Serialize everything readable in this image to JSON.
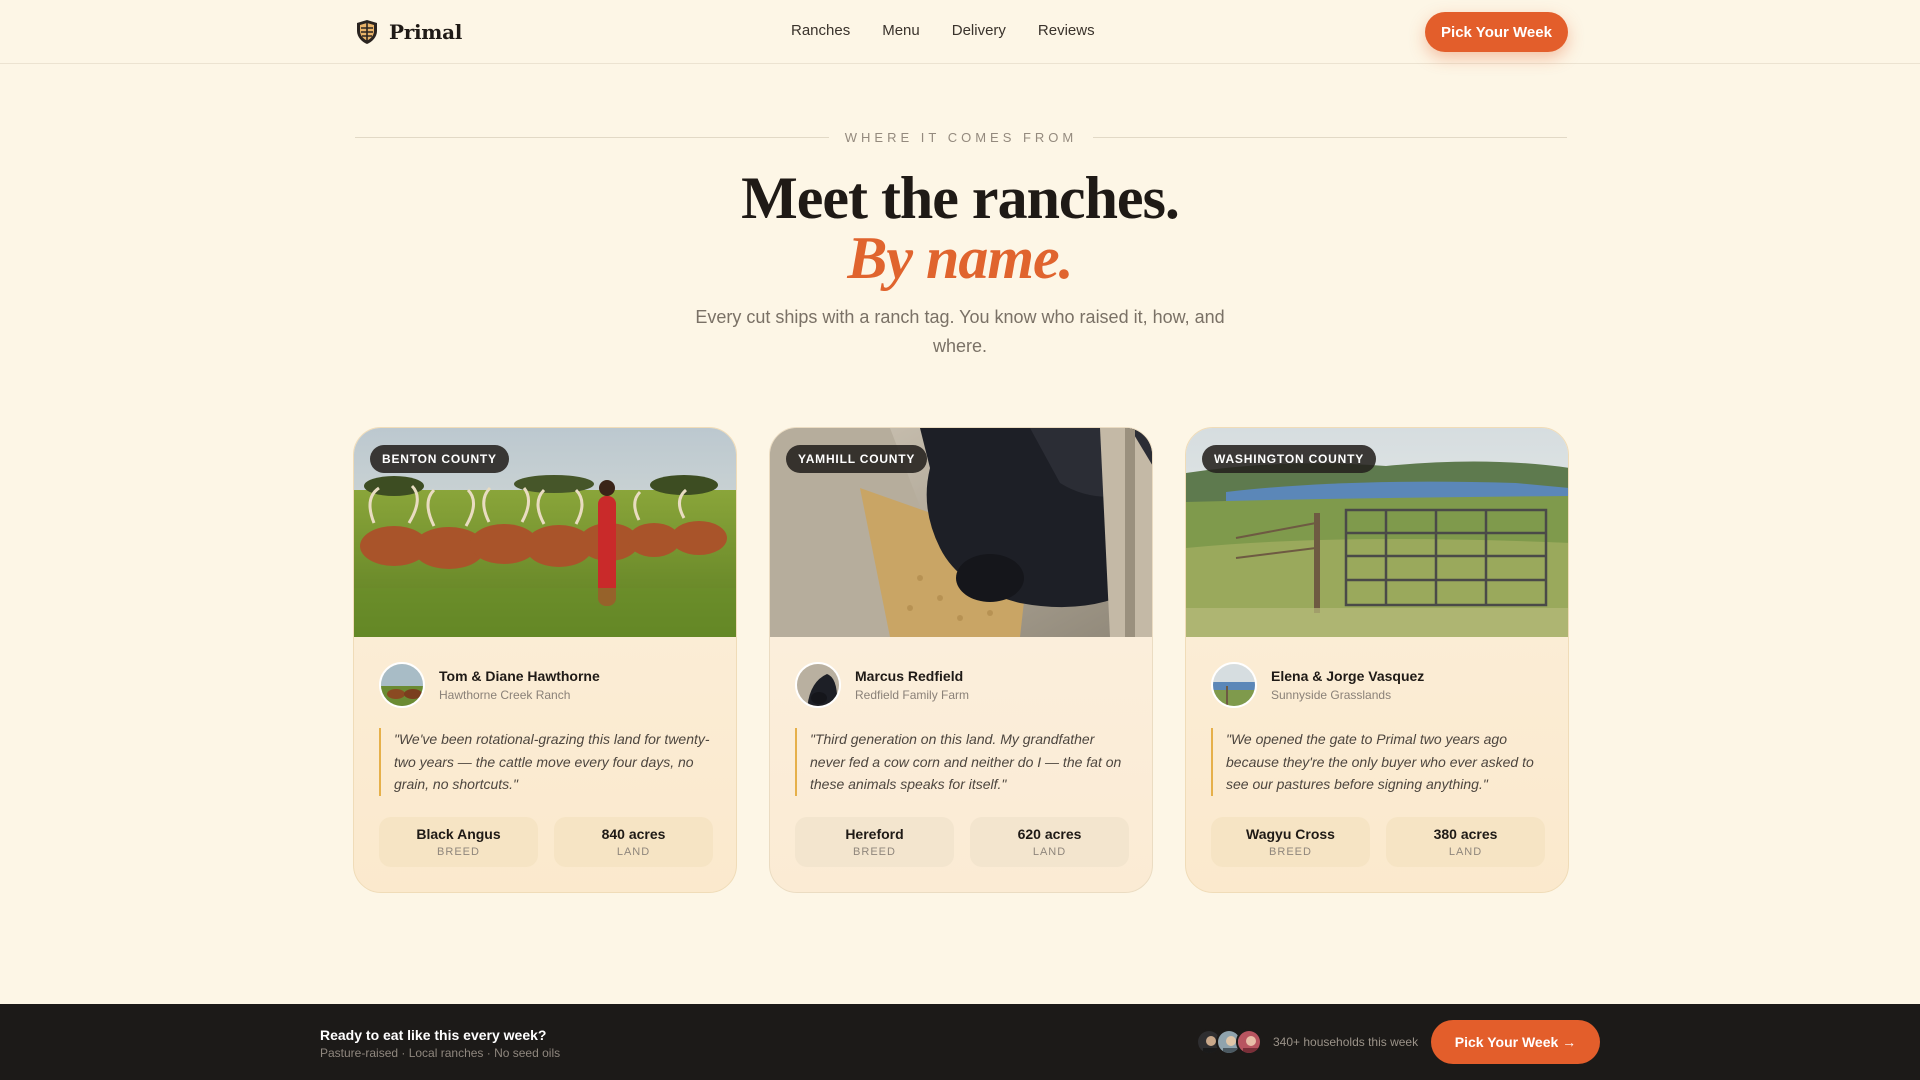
{
  "brand": {
    "name": "Primal",
    "logo_icon": "shield-icon"
  },
  "nav": {
    "links": [
      "Ranches",
      "Menu",
      "Delivery",
      "Reviews"
    ],
    "cta_label": "Pick Your Week"
  },
  "hero": {
    "eyebrow": "WHERE IT COMES FROM",
    "headline": "Meet the ranches.",
    "headline_accent": "By name.",
    "subhead": "Every cut ships with a ranch tag. You know who raised it, how, and where."
  },
  "ranches": [
    {
      "county": "BENTON COUNTY",
      "name": "Tom & Diane Hawthorne",
      "farm": "Hawthorne Creek Ranch",
      "quote": "\"We've been rotational-grazing this land for twenty-two years — the cattle move every four days, no grain, no shortcuts.\"",
      "breed": "Black Angus",
      "breed_label": "BREED",
      "land": "840 acres",
      "land_label": "LAND"
    },
    {
      "county": "YAMHILL COUNTY",
      "name": "Marcus Redfield",
      "farm": "Redfield Family Farm",
      "quote": "\"Third generation on this land. My grandfather never fed a cow corn and neither do I — the fat on these animals speaks for itself.\"",
      "breed": "Hereford",
      "breed_label": "BREED",
      "land": "620 acres",
      "land_label": "LAND"
    },
    {
      "county": "WASHINGTON COUNTY",
      "name": "Elena & Jorge Vasquez",
      "farm": "Sunnyside Grasslands",
      "quote": "\"We opened the gate to Primal two years ago because they're the only buyer who ever asked to see our pastures before signing anything.\"",
      "breed": "Wagyu Cross",
      "breed_label": "BREED",
      "land": "380 acres",
      "land_label": "LAND"
    }
  ],
  "bottom_bar": {
    "title": "Ready to eat like this every week?",
    "subtitle": "Pasture-raised · Local ranches · No seed oils",
    "households": "340+ households this week",
    "cta_label": "Pick Your Week →"
  },
  "colors": {
    "background": "#fdf6e6",
    "accent": "#e35e2b",
    "accent_text": "#e0642e",
    "quote_rule": "#e6b04a",
    "bottom_bar": "#1c1a18"
  }
}
